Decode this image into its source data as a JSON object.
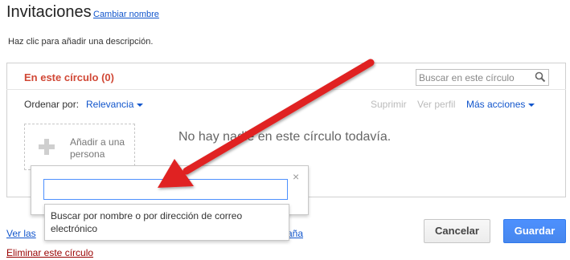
{
  "header": {
    "title": "Invitaciones",
    "rename_link": "Cambiar nombre",
    "description": "Haz clic para añadir una descripción."
  },
  "circle": {
    "label": "En este círculo (0)",
    "search_placeholder": "Buscar en este círculo",
    "sort_label": "Ordenar por:",
    "sort_value": "Relevancia",
    "actions": {
      "delete": "Suprimir",
      "view_profile": "Ver perfil",
      "more": "Más acciones"
    },
    "add_person": "Añadir a una persona",
    "empty_message": "No hay nadie en este círculo todavía."
  },
  "popup": {
    "close": "×",
    "input_value": "",
    "suggestion": "Buscar por nombre o por dirección de correo electrónico"
  },
  "footer": {
    "link_left": "Ver las",
    "link_right": "aña",
    "delete_circle": "Eliminar este círculo",
    "cancel": "Cancelar",
    "save": "Guardar"
  },
  "colors": {
    "circle_label": "#d14836",
    "link": "#1155cc",
    "delete_link": "#990000",
    "save_button": "#4d90fe",
    "arrow": "#e02020"
  },
  "icons": {
    "search": "search-icon",
    "add": "plus-icon",
    "close": "close-icon",
    "arrow": "red-arrow-annotation"
  }
}
